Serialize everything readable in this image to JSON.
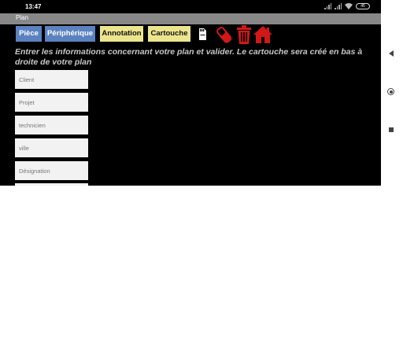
{
  "status_bar": {
    "time": "13:47",
    "battery": "45"
  },
  "app": {
    "title": "Plan"
  },
  "toolbar": {
    "buttons": [
      {
        "label": "Pièce",
        "style": "blue"
      },
      {
        "label": "Périphérique",
        "style": "blue"
      },
      {
        "label": "Annotation",
        "style": "yellow"
      },
      {
        "label": "Cartouche",
        "style": "yellow"
      }
    ],
    "icons": [
      "sd-card-icon",
      "eraser-icon",
      "trash-icon",
      "home-icon"
    ]
  },
  "instructions": "Entrer les informations concernant votre plan et valider. Le cartouche sera créé en bas à droite de votre plan",
  "form": {
    "fields": [
      {
        "placeholder": "Client",
        "value": ""
      },
      {
        "placeholder": "Projet",
        "value": ""
      },
      {
        "placeholder": "technicien",
        "value": ""
      },
      {
        "placeholder": "ville",
        "value": ""
      },
      {
        "placeholder": "Désignation",
        "value": ""
      },
      {
        "placeholder": "",
        "value": ""
      }
    ]
  },
  "colors": {
    "background": "#000000",
    "title_bar": "#888888",
    "button_blue": "#5b82c0",
    "button_yellow": "#ece58e",
    "icon_red": "#d01818",
    "instructions_text": "#c8c8c8",
    "field_background": "#f2f2f2"
  }
}
